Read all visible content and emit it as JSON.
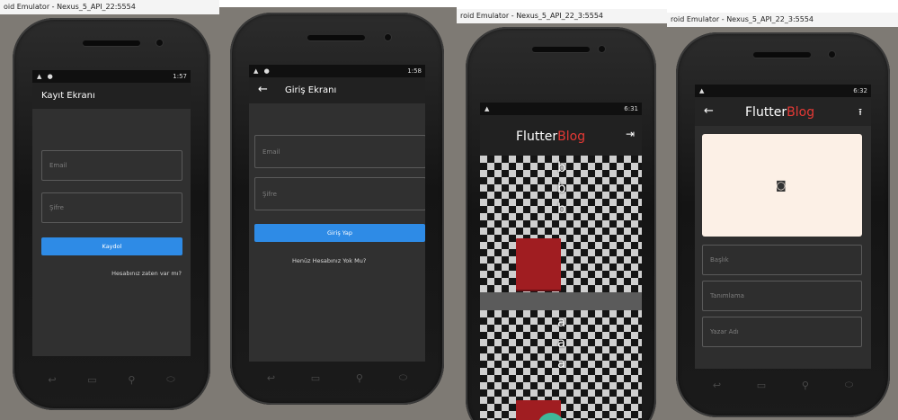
{
  "windows": [
    {
      "title": "oid Emulator - Nexus_5_API_22:5554"
    },
    {
      "title": ""
    },
    {
      "title": "roid Emulator - Nexus_5_API_22_3:5554"
    },
    {
      "title": "roid Emulator - Nexus_5_API_22_3:5554"
    }
  ],
  "status": {
    "s1_time": "1:57",
    "s2_time": "1:58",
    "s3_time": "6:31",
    "s4_time": "6:32"
  },
  "register": {
    "title": "Kayıt Ekranı",
    "email_placeholder": "Email",
    "password_placeholder": "Şifre",
    "button": "Kaydol",
    "link": "Hesabınız zaten var mı?"
  },
  "login": {
    "title": "Giriş Ekranı",
    "email_placeholder": "Email",
    "password_placeholder": "Şifre",
    "button": "Giriş Yap",
    "link": "Henüz Hesabınız Yok Mu?"
  },
  "feed": {
    "brand_part1": "Flutter",
    "brand_part2": "Blog",
    "post1_letters": [
      "b",
      "b",
      "b"
    ],
    "post2_letters": [
      "a",
      "a",
      "a"
    ],
    "fab_label": "+"
  },
  "add_post": {
    "brand_part1": "Flutter",
    "brand_part2": "Blog",
    "title_placeholder": "Başlık",
    "description_placeholder": "Tanımlama",
    "author_placeholder": "Yazar Adı"
  },
  "nav": {
    "back": "↩",
    "home": "▭",
    "search": "⚲",
    "recent": "⬭"
  },
  "colors": {
    "accent_blue": "#2e8be6",
    "brand_red": "#e53935",
    "post_red": "#a01d21",
    "fab_teal": "#3fb79a",
    "image_placeholder": "#fcf0e6"
  }
}
